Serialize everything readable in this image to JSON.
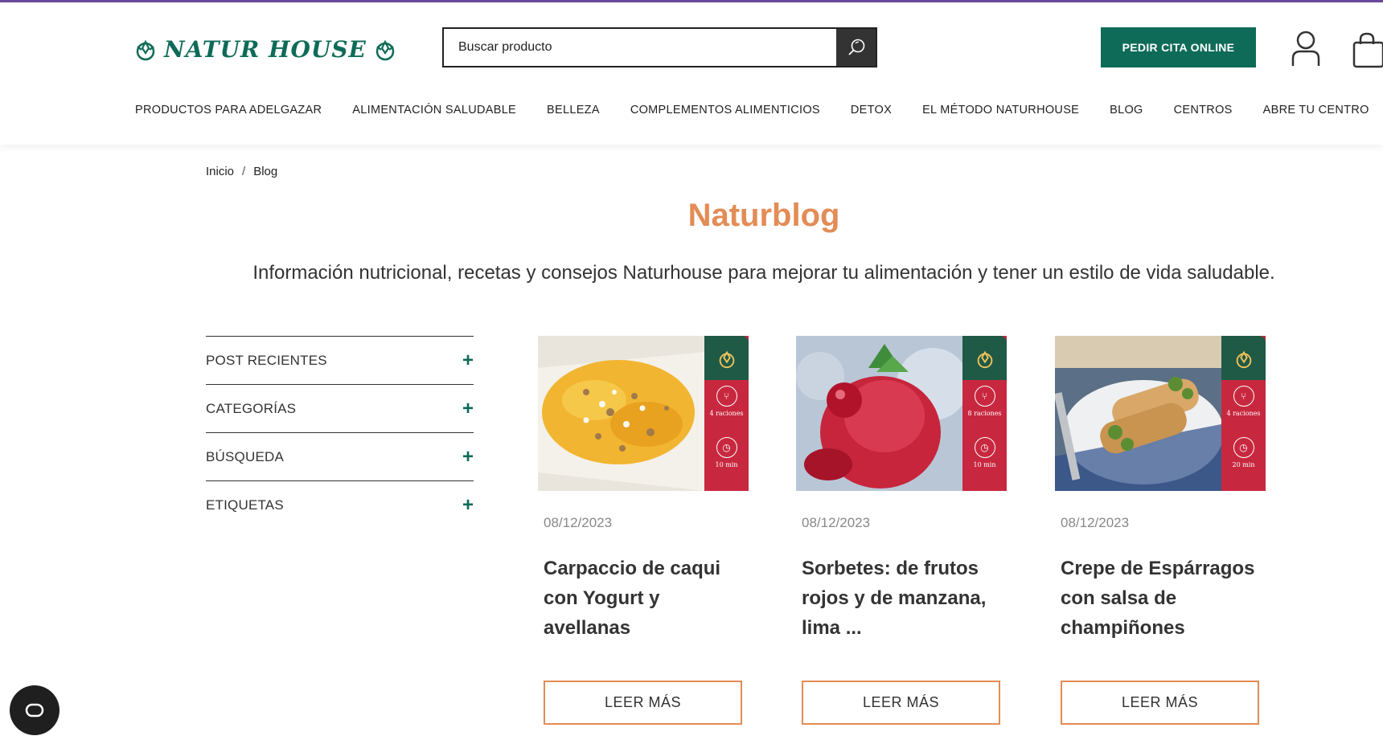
{
  "header": {
    "logo_text": "NATUR HOUSE",
    "search_placeholder": "Buscar producto",
    "cta_label": "PEDIR CITA ONLINE",
    "brand_color": "#0e6b58"
  },
  "nav": {
    "items": [
      {
        "label": "PRODUCTOS PARA ADELGAZAR"
      },
      {
        "label": "ALIMENTACIÓN SALUDABLE"
      },
      {
        "label": "BELLEZA"
      },
      {
        "label": "COMPLEMENTOS ALIMENTICIOS"
      },
      {
        "label": "DETOX"
      },
      {
        "label": "EL MÉTODO NATURHOUSE"
      },
      {
        "label": "BLOG"
      },
      {
        "label": "CENTROS"
      },
      {
        "label": "ABRE TU CENTRO"
      }
    ]
  },
  "breadcrumb": {
    "home": "Inicio",
    "separator": "/",
    "current": "Blog"
  },
  "page": {
    "title": "Naturblog",
    "subtitle": "Información nutricional, recetas y consejos Naturhouse para mejorar tu alimentación y tener un estilo de vida saludable.",
    "accent_color": "#e38c56"
  },
  "sidebar": {
    "sections": [
      {
        "label": "POST RECIENTES",
        "toggle": "+"
      },
      {
        "label": "CATEGORÍAS",
        "toggle": "+"
      },
      {
        "label": "BÚSQUEDA",
        "toggle": "+"
      },
      {
        "label": "ETIQUETAS",
        "toggle": "+"
      }
    ]
  },
  "posts": [
    {
      "date": "08/12/2023",
      "title": "Carpaccio de caqui con Yogurt y avellanas",
      "button": "LEER MÁS",
      "servings": "4 raciones",
      "time": "10 min"
    },
    {
      "date": "08/12/2023",
      "title": "Sorbetes: de frutos rojos y de manzana, lima ...",
      "button": "LEER MÁS",
      "servings": "8 raciones",
      "time": "10 min"
    },
    {
      "date": "08/12/2023",
      "title": "Crepe de Espárragos con salsa de champiñones",
      "button": "LEER MÁS",
      "servings": "4 raciones",
      "time": "20 min"
    }
  ]
}
